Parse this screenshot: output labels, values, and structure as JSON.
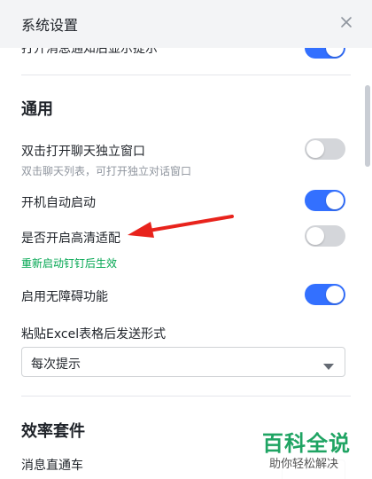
{
  "header": {
    "title": "系统设置",
    "close_icon": "close-icon"
  },
  "top_cut_row": {
    "label": "打开消息通知后显示提示",
    "enabled": true
  },
  "general": {
    "title": "通用",
    "double_click": {
      "label": "双击打开聊天独立窗口",
      "sub": "双击聊天列表，可打开独立对话窗口",
      "enabled": false
    },
    "auto_start": {
      "label": "开机自动启动",
      "enabled": true
    },
    "hd_adapt": {
      "label": "是否开启高清适配",
      "note": "重新启动钉钉后生效",
      "enabled": false
    },
    "accessibility": {
      "label": "启用无障碍功能",
      "enabled": true
    },
    "excel_paste": {
      "label": "粘贴Excel表格后发送形式",
      "selected": "每次提示"
    }
  },
  "efficiency": {
    "title": "效率套件",
    "message_train": {
      "label": "消息直通车"
    }
  },
  "watermark": {
    "main": "百科全说",
    "sub": "助你轻松解决"
  },
  "colors": {
    "accent": "#3370ff",
    "toggle_off": "#d4d6da",
    "note_green": "#00a650",
    "arrow_red": "#e8231c",
    "watermark_green": "#1fa463"
  }
}
